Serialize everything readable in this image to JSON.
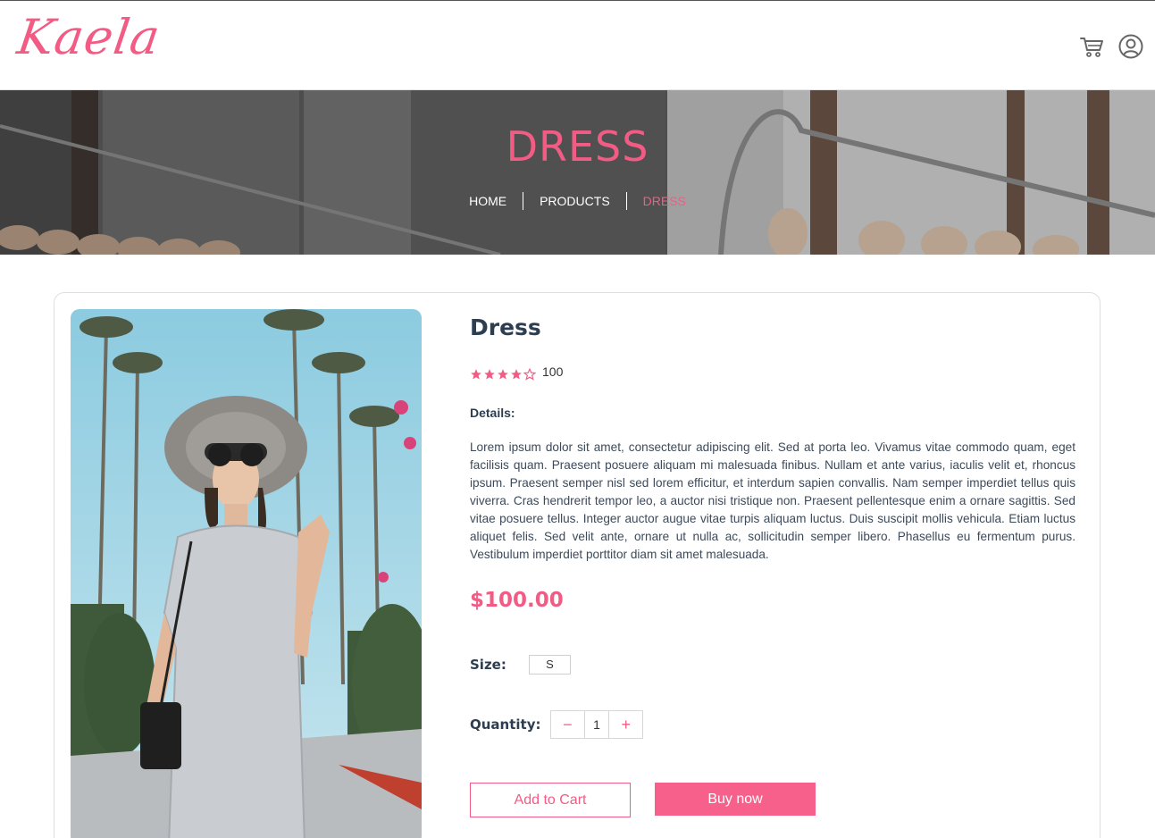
{
  "header": {
    "logo": "Kaela",
    "cart_icon": "cart-icon",
    "account_icon": "user-circle-icon"
  },
  "hero": {
    "title": "DRESS",
    "breadcrumb": [
      "HOME",
      "PRODUCTS",
      "DRESS"
    ]
  },
  "product": {
    "name": "Dress",
    "rating": 4,
    "rating_max": 5,
    "rating_count": "100",
    "details_label": "Details:",
    "description": "Lorem ipsum dolor sit amet, consectetur adipiscing elit. Sed at porta leo. Vivamus vitae commodo quam, eget facilisis quam. Praesent posuere aliquam mi malesuada finibus. Nullam et ante varius, iaculis velit et, rhoncus ipsum. Praesent semper nisl sed lorem efficitur, et interdum sapien convallis. Nam semper imperdiet tellus quis viverra. Cras hendrerit tempor leo, a auctor nisi tristique non. Praesent pellentesque enim a ornare sagittis. Sed vitae posuere tellus. Integer auctor augue vitae turpis aliquam luctus. Duis suscipit mollis vehicula. Etiam luctus aliquet felis. Sed velit ante, ornare ut nulla ac, sollicitudin semper libero. Phasellus eu fermentum purus. Vestibulum imperdiet porttitor diam sit amet malesuada.",
    "price": "$100.00",
    "size_label": "Size:",
    "size_value": "S",
    "quantity_label": "Quantity:",
    "quantity_minus": "−",
    "quantity_value": "1",
    "quantity_plus": "+",
    "add_to_cart": "Add to Cart",
    "buy_now": "Buy now"
  },
  "colors": {
    "accent": "#f25c84",
    "text": "#2c3e50"
  }
}
